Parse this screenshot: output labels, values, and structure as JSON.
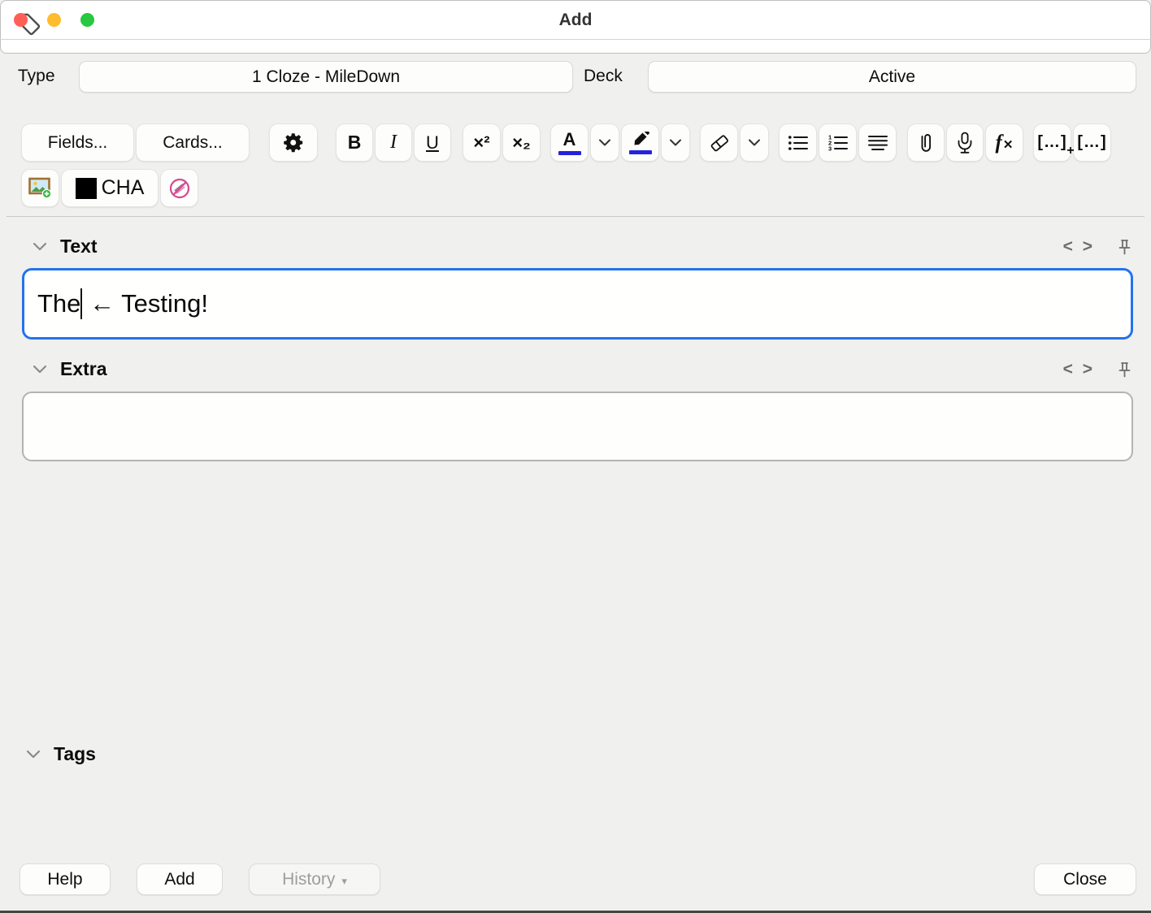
{
  "window": {
    "title": "Add"
  },
  "header": {
    "type_label": "Type",
    "type_value": "1 Cloze - MileDown",
    "deck_label": "Deck",
    "deck_value": "Active"
  },
  "toolbar": {
    "fields": "Fields...",
    "cards": "Cards...",
    "bold": "B",
    "italic": "I",
    "underline": "U",
    "superscript": "×²",
    "subscript": "×₂",
    "text_color_letter": "A",
    "cloze_base": "[…]",
    "cloze_plus": "+",
    "cloze_alt": "[…]",
    "cha_label": "CHA"
  },
  "sections": {
    "text": {
      "label": "Text",
      "value_before_cursor": "The",
      "value_after_cursor": " ← Testing!",
      "code_icon_label": "< >"
    },
    "extra": {
      "label": "Extra",
      "value": "",
      "code_icon_label": "< >"
    },
    "tags": {
      "label": "Tags",
      "value": ""
    }
  },
  "footer": {
    "help": "Help",
    "add": "Add",
    "history": "History",
    "history_arrow": "▾",
    "close": "Close"
  },
  "icons": {
    "toolbar": [
      "gear-icon",
      "chevron-down-icon",
      "highlighter-icon",
      "eraser-icon",
      "bullet-list-icon",
      "numbered-list-icon",
      "justify-icon",
      "paperclip-icon",
      "microphone-icon",
      "function-icon",
      "add-image-icon",
      "no-highlight-icon"
    ],
    "field_header": [
      "chevron-down-icon",
      "html-code-icon",
      "pin-icon"
    ],
    "tags": [
      "tag-icon"
    ]
  },
  "colors": {
    "focus_border": "#2273f0",
    "accent_underline": "#2323dd",
    "traffic_red": "#ff5f57",
    "traffic_yellow": "#febc2e",
    "traffic_green": "#28c840"
  }
}
